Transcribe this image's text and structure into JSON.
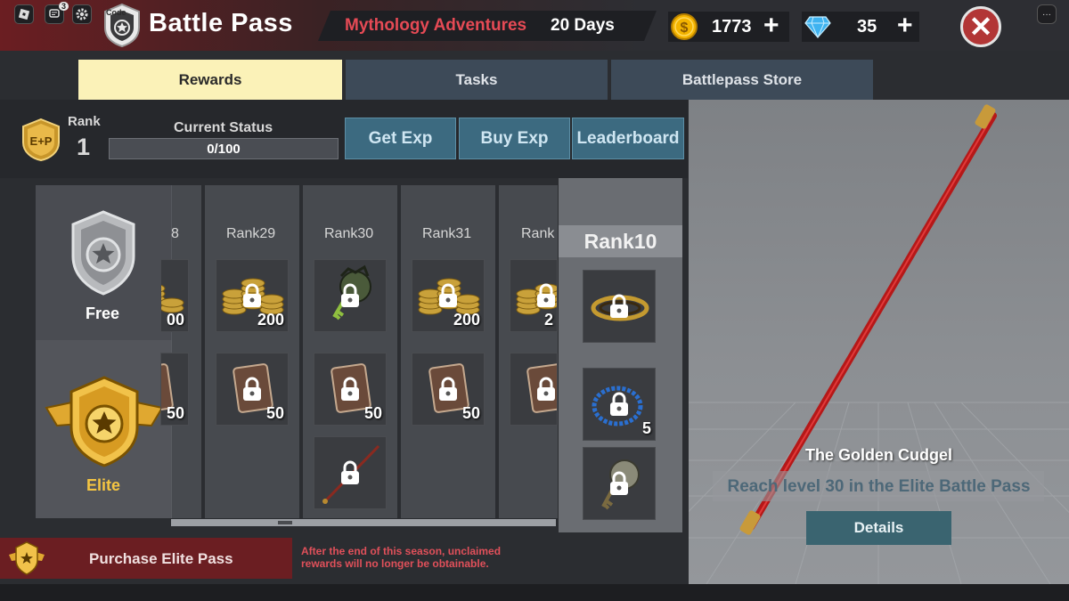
{
  "topbar": {
    "notification_count": "3",
    "code_label": "Code",
    "title": "Battle Pass",
    "season_name": "Mythology Adventures",
    "season_days": "20 Days",
    "coins": "1773",
    "gems": "35",
    "coin_color": "#f4b400",
    "gem_color": "#5ec8f7"
  },
  "tabs": [
    {
      "label": "Rewards",
      "active": true
    },
    {
      "label": "Tasks",
      "active": false
    },
    {
      "label": "Battlepass Store",
      "active": false
    }
  ],
  "status": {
    "rank_label": "Rank",
    "rank_value": "1",
    "status_label": "Current Status",
    "progress_text": "0/100",
    "progress_fraction": 0.0,
    "exp_badge_text": "E+P"
  },
  "actions": {
    "get_exp": "Get Exp",
    "buy_exp": "Buy Exp",
    "leaderboard": "Leaderboard"
  },
  "tracks": {
    "free": "Free",
    "elite": "Elite"
  },
  "ranks": [
    {
      "label": "8",
      "free_qty": "00",
      "elite_qty": "50",
      "free_icon": "gold-coins",
      "elite_icon": "exp-card"
    },
    {
      "label": "Rank29",
      "free_qty": "200",
      "elite_qty": "50",
      "free_icon": "gold-coins",
      "elite_icon": "exp-card"
    },
    {
      "label": "Rank30",
      "free_qty": "",
      "elite_qty": "50",
      "free_icon": "skull-key",
      "elite_icon": "exp-card",
      "extra_icon": "staff"
    },
    {
      "label": "Rank31",
      "free_qty": "200",
      "elite_qty": "50",
      "free_icon": "gold-coins",
      "elite_icon": "exp-card"
    },
    {
      "label": "Rank",
      "free_qty": "2",
      "elite_qty": "",
      "free_icon": "gold-coins",
      "elite_icon": "exp-card"
    }
  ],
  "highlight": {
    "label": "Rank10",
    "free_icon": "golden-ring",
    "elite_icons": [
      "blue-bead-necklace",
      "skull-key"
    ],
    "elite_qty": "5"
  },
  "purchase": {
    "label": "Purchase Elite Pass",
    "note": "After the end of this season, unclaimed rewards will no longer be obtainable."
  },
  "preview": {
    "item_name": "The Golden Cudgel",
    "item_desc": "Reach level 30 in the Elite Battle Pass",
    "details": "Details"
  }
}
